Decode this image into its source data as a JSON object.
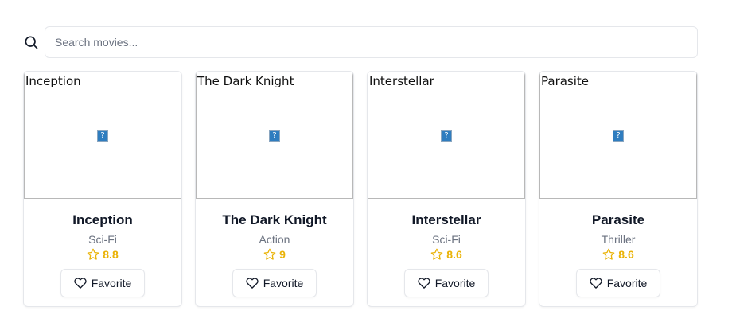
{
  "search": {
    "icon": "search-icon",
    "placeholder": "Search movies...",
    "value": ""
  },
  "colors": {
    "rating": "#eab308",
    "text": "#111827",
    "muted": "#6b7280",
    "border": "#e5e7eb"
  },
  "movies": [
    {
      "alt": "Inception",
      "title": "Inception",
      "genre": "Sci-Fi",
      "rating": "8.8",
      "favorite_label": "Favorite"
    },
    {
      "alt": "The Dark Knight",
      "title": "The Dark Knight",
      "genre": "Action",
      "rating": "9",
      "favorite_label": "Favorite"
    },
    {
      "alt": "Interstellar",
      "title": "Interstellar",
      "genre": "Sci-Fi",
      "rating": "8.6",
      "favorite_label": "Favorite"
    },
    {
      "alt": "Parasite",
      "title": "Parasite",
      "genre": "Thriller",
      "rating": "8.6",
      "favorite_label": "Favorite"
    }
  ]
}
